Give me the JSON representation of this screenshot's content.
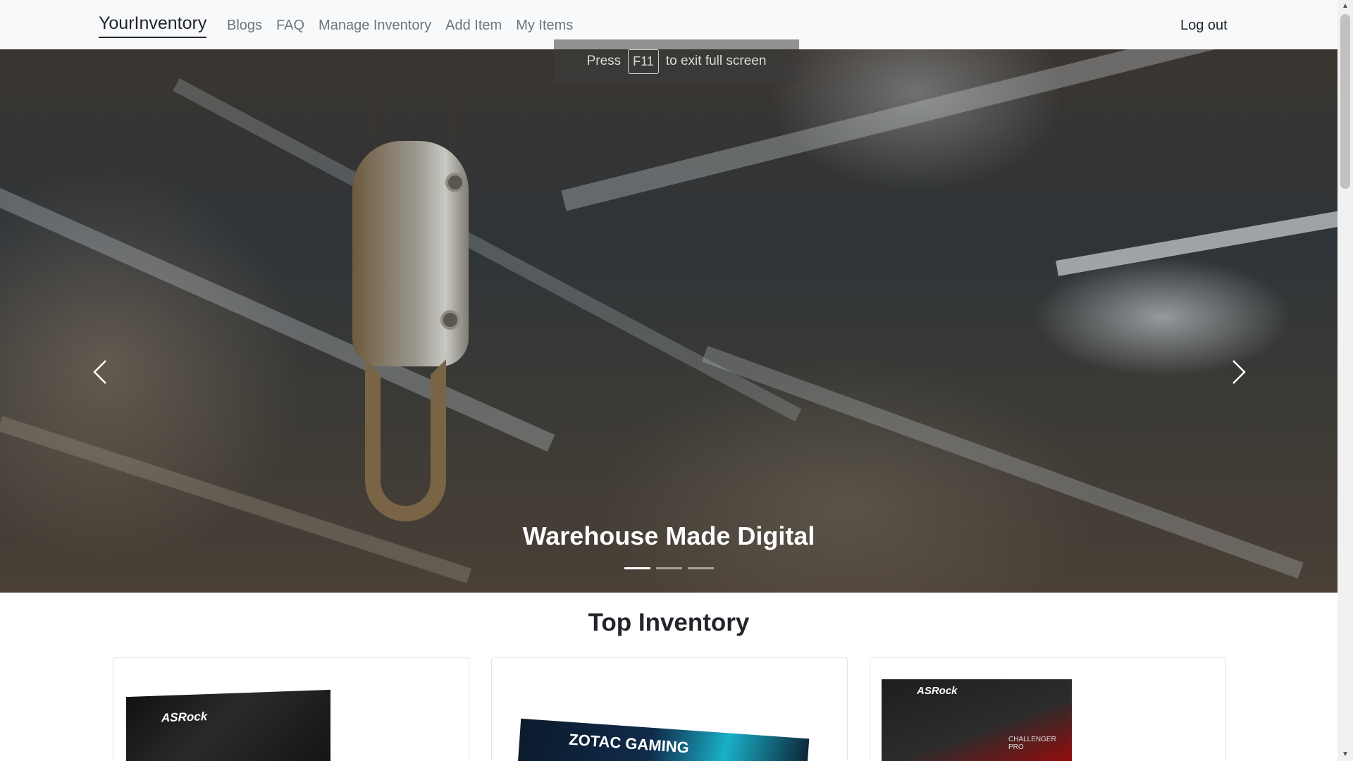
{
  "navbar": {
    "brand": "YourInventory",
    "links": [
      "Blogs",
      "FAQ",
      "Manage Inventory",
      "Add Item",
      "My Items"
    ],
    "logout": "Log out"
  },
  "fullscreen_notice": {
    "before": "Press",
    "key": "F11",
    "after": "to exit full screen"
  },
  "hero": {
    "caption": "Warehouse Made Digital",
    "slide_count": 3,
    "active_slide": 1
  },
  "section": {
    "title": "Top Inventory"
  },
  "cards": [
    {
      "brand_text": "ASRock"
    },
    {
      "brand_text": "ZOTAC GAMING"
    },
    {
      "brand_text": "ASRock",
      "sub_text": "CHALLENGER PRO"
    }
  ],
  "colors": {
    "navbar_bg": "#f8f9fa",
    "link_muted": "#6c757d",
    "text_dark": "#212529"
  }
}
